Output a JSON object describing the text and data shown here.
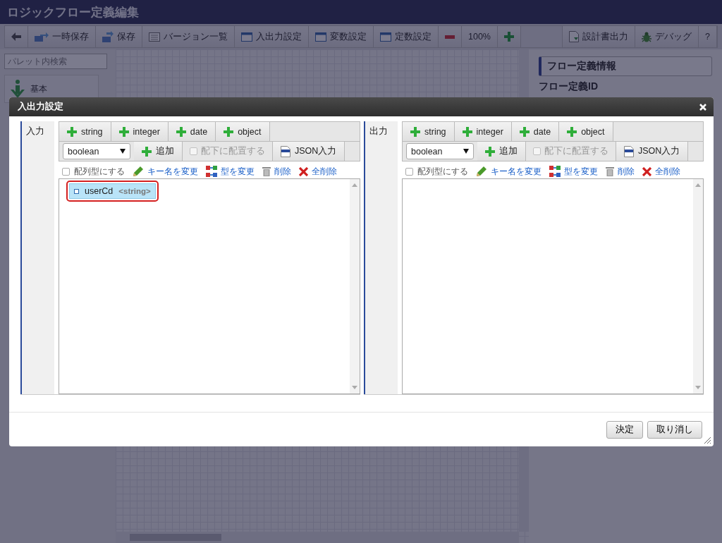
{
  "window": {
    "title": "ロジックフロー定義編集"
  },
  "toolbar": [
    {
      "kind": "back"
    },
    {
      "kind": "temp-save",
      "label": "一時保存"
    },
    {
      "kind": "save",
      "label": "保存"
    },
    {
      "kind": "list",
      "label": "バージョン一覧"
    },
    {
      "kind": "window",
      "label": "入出力設定"
    },
    {
      "kind": "window",
      "label": "変数設定"
    },
    {
      "kind": "window",
      "label": "定数設定"
    },
    {
      "kind": "zoom-out"
    },
    {
      "kind": "text",
      "label": "100%"
    },
    {
      "kind": "zoom-in"
    },
    {
      "kind": "doc",
      "label": "設計書出力",
      "group_start": true
    },
    {
      "kind": "bug",
      "label": "デバッグ"
    },
    {
      "kind": "text",
      "label": "?"
    }
  ],
  "palette": {
    "search": {
      "placeholder": "パレット内検索"
    },
    "items": [
      {
        "label": "基本"
      }
    ]
  },
  "info_panel": {
    "heading": "フロー定義情報",
    "field_label": "フロー定義ID"
  },
  "dialog": {
    "title": "入出力設定",
    "panels": [
      {
        "label": "入力",
        "add_types": [
          "string",
          "integer",
          "date",
          "object"
        ],
        "type_select": "boolean",
        "add_button": "追加",
        "nest_checkbox": {
          "label": "配下に配置する",
          "checked": false,
          "disabled": true
        },
        "json_button": "JSON入力",
        "array_checkbox": {
          "label": "配列型にする",
          "checked": false
        },
        "actions": [
          {
            "kind": "rename",
            "label": "キー名を変更"
          },
          {
            "kind": "retype",
            "label": "型を変更"
          },
          {
            "kind": "delete",
            "label": "削除"
          },
          {
            "kind": "delete-all",
            "label": "全削除"
          }
        ],
        "items": [
          {
            "name": "userCd",
            "type": "<string>",
            "selected": true,
            "highlighted": true
          }
        ]
      },
      {
        "label": "出力",
        "add_types": [
          "string",
          "integer",
          "date",
          "object"
        ],
        "type_select": "boolean",
        "add_button": "追加",
        "nest_checkbox": {
          "label": "配下に配置する",
          "checked": false,
          "disabled": true
        },
        "json_button": "JSON入力",
        "array_checkbox": {
          "label": "配列型にする",
          "checked": false
        },
        "actions": [
          {
            "kind": "rename",
            "label": "キー名を変更"
          },
          {
            "kind": "retype",
            "label": "型を変更"
          },
          {
            "kind": "delete",
            "label": "削除"
          },
          {
            "kind": "delete-all",
            "label": "全削除"
          }
        ]
      }
    ],
    "buttons": [
      "決定",
      "取り消し"
    ]
  }
}
